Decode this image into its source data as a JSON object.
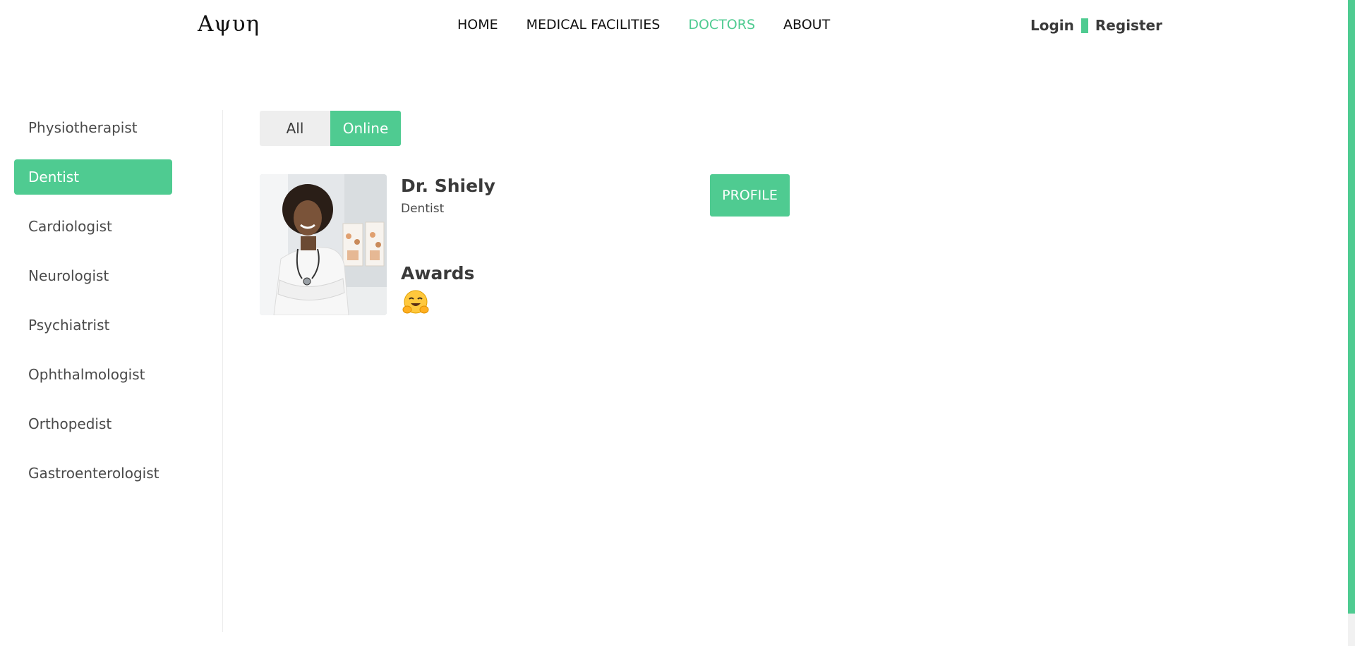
{
  "header": {
    "logo": "Αψυη",
    "nav": [
      {
        "label": "HOME",
        "active": false
      },
      {
        "label": "MEDICAL FACILITIES",
        "active": false
      },
      {
        "label": "DOCTORS",
        "active": true
      },
      {
        "label": "ABOUT",
        "active": false
      }
    ],
    "login_label": "Login",
    "register_label": "Register"
  },
  "sidebar": {
    "items": [
      {
        "label": "Physiotherapist",
        "active": false
      },
      {
        "label": "Dentist",
        "active": true
      },
      {
        "label": "Cardiologist",
        "active": false
      },
      {
        "label": "Neurologist",
        "active": false
      },
      {
        "label": "Psychiatrist",
        "active": false
      },
      {
        "label": "Ophthalmologist",
        "active": false
      },
      {
        "label": "Orthopedist",
        "active": false
      },
      {
        "label": "Gastroenterologist",
        "active": false
      }
    ]
  },
  "filter": {
    "all_label": "All",
    "online_label": "Online",
    "selected": "Online"
  },
  "doctor": {
    "name": "Dr. Shiely",
    "specialty": "Dentist",
    "profile_label": "PROFILE",
    "awards_title": "Awards",
    "award_icon": "hugging-face-emoji"
  },
  "colors": {
    "accent": "#4fcb91",
    "text": "#3a3a3a",
    "filter_inactive_bg": "#eeeeee"
  }
}
